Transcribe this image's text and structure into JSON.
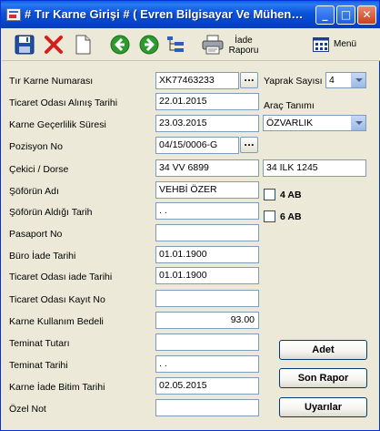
{
  "window": {
    "title": "# Tır Karne Girişi #  ( Evren Bilgisayar Ve Mühen…",
    "controls": {
      "minimize": "_",
      "maximize": "□",
      "close": "✕"
    }
  },
  "toolbar": {
    "iade_raporu_line1": "İade",
    "iade_raporu_line2": "Raporu",
    "menu_label": "Menü"
  },
  "form": {
    "tir_karne_numarasi": {
      "label": "Tır Karne Numarası",
      "value": "XK77463233"
    },
    "ticaret_odasi_alinis_tarihi": {
      "label": "Ticaret Odası Alınış Tarihi",
      "value": "22.01.2015"
    },
    "karne_gecerlilik_suresi": {
      "label": "Karne Geçerlilik Süresi",
      "value": "23.03.2015"
    },
    "pozisyon_no": {
      "label": "Pozisyon No",
      "value": "04/15/0006-G"
    },
    "cekici_dorse": {
      "label": "Çekici / Dorse",
      "cekici": "34 VV 6899",
      "dorse": "34 ILK 1245"
    },
    "soforun_adi": {
      "label": "Şöförün Adı",
      "value": "VEHBİ ÖZER"
    },
    "soforun_aldigi_tarih": {
      "label": "Şöförün Aldığı Tarih",
      "value": " .  ."
    },
    "pasaport_no": {
      "label": "Pasaport No",
      "value": ""
    },
    "buro_iade_tarihi": {
      "label": "Büro İade Tarihi",
      "value": "01.01.1900"
    },
    "ticaret_odasi_iade_tarihi": {
      "label": "Ticaret Odası iade Tarihi",
      "value": "01.01.1900"
    },
    "ticaret_odasi_kayit_no": {
      "label": "Ticaret Odası Kayıt No",
      "value": ""
    },
    "karne_kullanim_bedeli": {
      "label": "Karne Kullanım Bedeli",
      "value": "93.00"
    },
    "teminat_tutari": {
      "label": "Teminat Tutarı",
      "value": ""
    },
    "teminat_tarihi": {
      "label": "Teminat Tarihi",
      "value": " .  ."
    },
    "karne_iade_bitim_tarihi": {
      "label": "Karne İade Bitim Tarihi",
      "value": "02.05.2015"
    },
    "ozel_not": {
      "label": "Özel Not",
      "value": ""
    },
    "lookup_button": "..."
  },
  "right_panel": {
    "yaprak_sayisi": {
      "label": "Yaprak Sayısı",
      "value": "4"
    },
    "arac_tanimi": {
      "label": "Araç Tanımı",
      "value": "ÖZVARLIK"
    },
    "checkbox_4ab": {
      "label": "4 AB",
      "checked": false
    },
    "checkbox_6ab": {
      "label": "6 AB",
      "checked": false
    },
    "buttons": {
      "adet": "Adet",
      "son_rapor": "Son Rapor",
      "uyarilar": "Uyarılar"
    }
  },
  "colors": {
    "titlebar": "#0a53d8",
    "window_bg": "#ece9d8",
    "field_border": "#7f9db9",
    "button_border": "#003c74"
  }
}
